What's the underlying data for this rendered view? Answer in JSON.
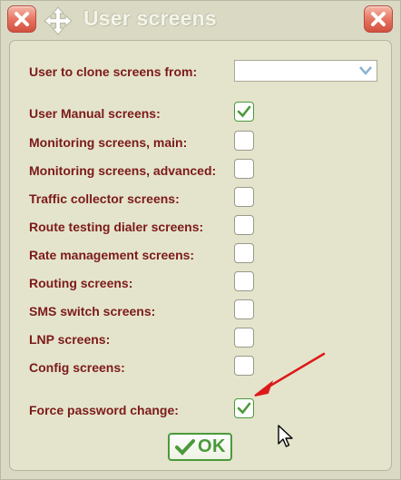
{
  "window": {
    "title": "User screens",
    "close_icon": "close-icon",
    "move_icon": "move-icon"
  },
  "form": {
    "clone_label": "User to clone screens from:",
    "clone_value": "",
    "rows": [
      {
        "label": "User Manual screens:",
        "checked": true
      },
      {
        "label": "Monitoring screens, main:",
        "checked": false
      },
      {
        "label": "Monitoring screens, advanced:",
        "checked": false
      },
      {
        "label": "Traffic collector screens:",
        "checked": false
      },
      {
        "label": "Route testing dialer screens:",
        "checked": false
      },
      {
        "label": "Rate management screens:",
        "checked": false
      },
      {
        "label": "Routing screens:",
        "checked": false
      },
      {
        "label": "SMS switch screens:",
        "checked": false
      },
      {
        "label": "LNP screens:",
        "checked": false
      },
      {
        "label": "Config screens:",
        "checked": false
      }
    ],
    "force_password_label": "Force password change:",
    "force_password_checked": true
  },
  "buttons": {
    "ok_label": "OK"
  },
  "colors": {
    "label": "#7c1a1a",
    "accent_green": "#4a9a3a",
    "close_red": "#e4705e",
    "annotation_red": "#dd1a1a"
  }
}
